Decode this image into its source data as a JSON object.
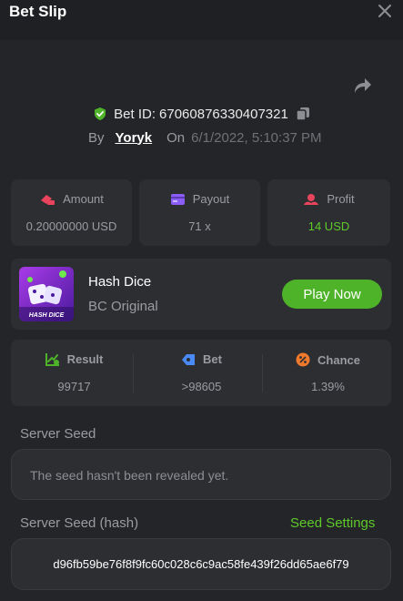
{
  "header": {
    "title": "Bet Slip"
  },
  "bet": {
    "id_label": "Bet ID:",
    "id_value": "67060876330407321",
    "by_label": "By",
    "user": "Yoryk",
    "on_label": "On",
    "date": "6/1/2022, 5:10:37 PM"
  },
  "stats": {
    "amount": {
      "label": "Amount",
      "value": "0.20000000 USD"
    },
    "payout": {
      "label": "Payout",
      "value": "71 x"
    },
    "profit": {
      "label": "Profit",
      "value": "14 USD"
    }
  },
  "game": {
    "name": "Hash Dice",
    "provider": "BC Original",
    "thumb_caption": "HASH DICE",
    "play_label": "Play Now"
  },
  "result": {
    "result": {
      "label": "Result",
      "value": "99717"
    },
    "bet": {
      "label": "Bet",
      "value": ">98605"
    },
    "chance": {
      "label": "Chance",
      "value": "1.39%"
    }
  },
  "seeds": {
    "server_seed_label": "Server Seed",
    "server_seed_value": "The seed hasn't been revealed yet.",
    "server_seed_hash_label": "Server Seed (hash)",
    "seed_settings_label": "Seed Settings",
    "server_seed_hash_value": "d96fb59be76f8f9fc60c028c6c9ac58fe439f26dd65ae6f79"
  },
  "colors": {
    "accent_green": "#4fb32a",
    "profit_green": "#5fc92a",
    "background": "#232528",
    "card": "#2c2e32"
  },
  "icons": {
    "close": "close-icon",
    "share": "share-icon",
    "verified": "shield-check-icon",
    "copy": "copy-icon",
    "amount": "coins-icon",
    "payout": "wallet-icon",
    "profit": "profit-icon",
    "result": "chart-icon",
    "bet": "ticket-icon",
    "chance": "percent-icon"
  }
}
